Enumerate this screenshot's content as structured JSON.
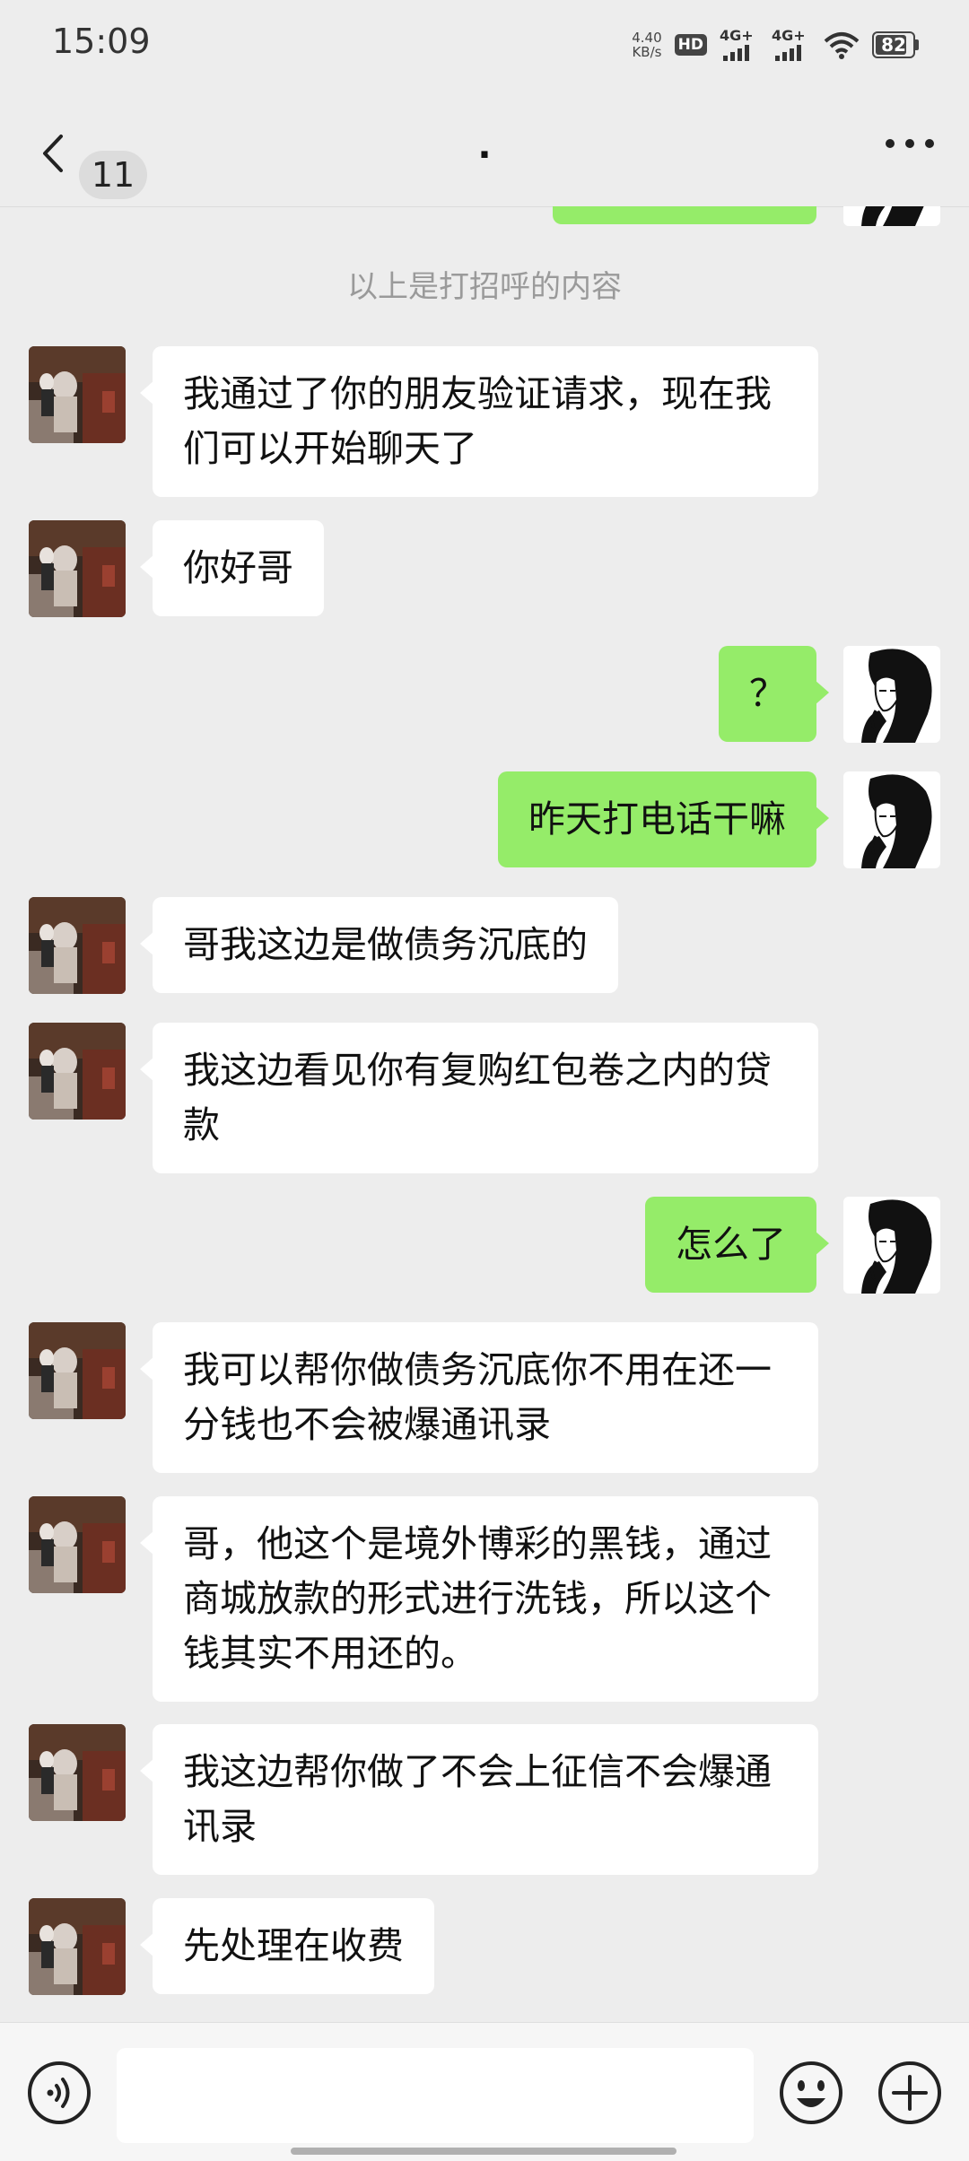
{
  "status_bar": {
    "time": "15:09",
    "net_speed_value": "4.40",
    "net_speed_unit": "KB/s",
    "hd_label": "HD",
    "signal1_label": "4G+",
    "signal2_label": "4G+",
    "battery": "82",
    "icons": [
      "hd-icon",
      "signal-4g-icon",
      "signal-4g-icon",
      "wifi-icon",
      "battery-icon"
    ]
  },
  "header": {
    "back_count": "11",
    "title": ".",
    "icons": [
      "back-chevron-icon",
      "more-dots-icon"
    ]
  },
  "chat": {
    "system_note": "以上是打招呼的内容",
    "messages": [
      {
        "side": "in",
        "text": "我通过了你的朋友验证请求，现在我们可以开始聊天了"
      },
      {
        "side": "in",
        "text": "你好哥"
      },
      {
        "side": "out",
        "text": "？"
      },
      {
        "side": "out",
        "text": "昨天打电话干嘛"
      },
      {
        "side": "in",
        "text": "哥我这边是做债务沉底的"
      },
      {
        "side": "in",
        "text": "我这边看见你有复购红包卷之内的贷款"
      },
      {
        "side": "out",
        "text": "怎么了"
      },
      {
        "side": "in",
        "text": "我可以帮你做债务沉底你不用在还一分钱也不会被爆通讯录"
      },
      {
        "side": "in",
        "text": "哥，他这个是境外博彩的黑钱，通过商城放款的形式进行洗钱，所以这个钱其实不用还的。"
      },
      {
        "side": "in",
        "text": "我这边帮你做了不会上征信不会爆通讯录"
      },
      {
        "side": "in",
        "text": "先处理在收费"
      }
    ]
  },
  "input_bar": {
    "text_value": "",
    "icons": [
      "voice-icon",
      "emoji-icon",
      "plus-icon"
    ]
  },
  "colors": {
    "background": "#ededed",
    "outgoing_bubble": "#95ec69",
    "incoming_bubble": "#ffffff",
    "system_text": "#9a9a9a"
  }
}
